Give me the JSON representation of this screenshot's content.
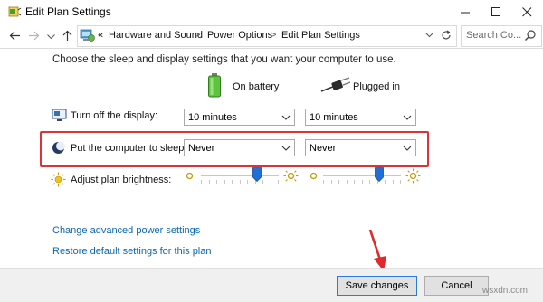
{
  "window": {
    "title": "Edit Plan Settings",
    "controls": [
      "minimize",
      "maximize",
      "close"
    ]
  },
  "address_bar": {
    "prefix": "«",
    "breadcrumbs": [
      "Hardware and Sound",
      "Power Options",
      "Edit Plan Settings"
    ],
    "separator": ">",
    "search_placeholder": "Search Co..."
  },
  "main": {
    "heading": "Choose the sleep and display settings that you want your computer to use.",
    "columns": {
      "on_battery": "On battery",
      "plugged_in": "Plugged in"
    },
    "rows": {
      "display": {
        "label": "Turn off the display:",
        "on_battery": "10 minutes",
        "plugged_in": "10 minutes"
      },
      "sleep": {
        "label": "Put the computer to sleep:",
        "on_battery": "Never",
        "plugged_in": "Never"
      },
      "brightness": {
        "label": "Adjust plan brightness:",
        "on_battery_level": 0.75,
        "plugged_in_level": 0.75
      }
    },
    "links": {
      "advanced": "Change advanced power settings",
      "restore": "Restore default settings for this plan"
    }
  },
  "footer": {
    "save_label": "Save changes",
    "cancel_label": "Cancel"
  },
  "watermark": "wsxdn.com",
  "colors": {
    "highlight": "#d9343a",
    "link": "#0b66b2",
    "accent": "#2b7bd6"
  }
}
